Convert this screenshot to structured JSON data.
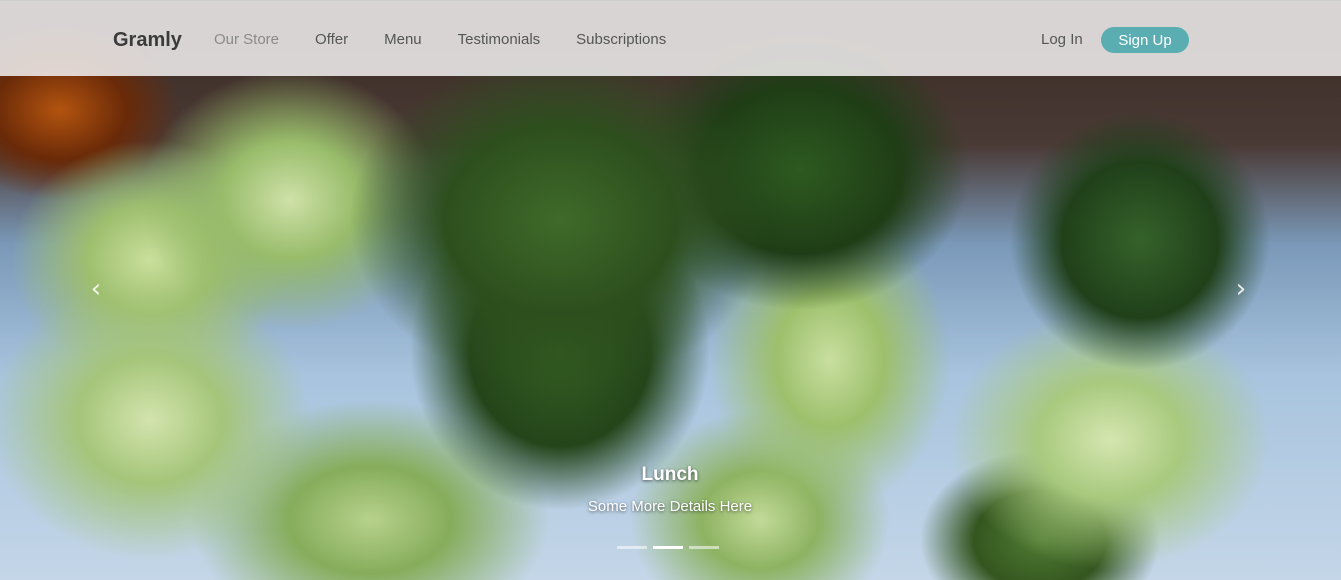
{
  "navbar": {
    "brand": "Gramly",
    "links": [
      {
        "label": "Our Store"
      },
      {
        "label": "Offer"
      },
      {
        "label": "Menu"
      },
      {
        "label": "Testimonials"
      },
      {
        "label": "Subscriptions"
      }
    ],
    "login_label": "Log In",
    "signup_label": "Sign Up"
  },
  "carousel": {
    "prev_icon": "‹",
    "next_icon": "›",
    "caption_title": "Lunch",
    "caption_text": "Some More Details Here",
    "slide_count": 3,
    "active_slide": 2
  },
  "colors": {
    "accent": "#5aaeb2",
    "navbar_bg": "#eeecec"
  }
}
